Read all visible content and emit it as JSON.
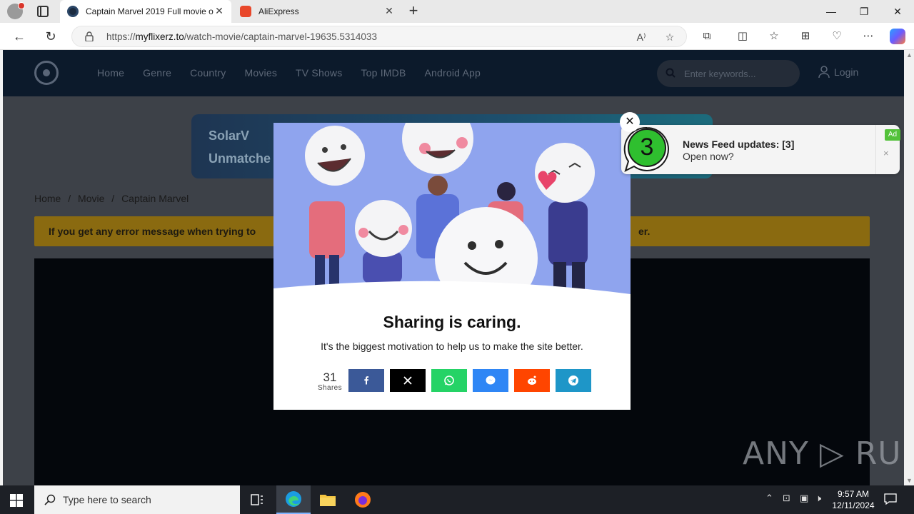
{
  "browser": {
    "tabs": [
      {
        "title": "Captain Marvel 2019 Full movie o",
        "active": true,
        "favicon": "film-reel-icon"
      },
      {
        "title": "AliExpress",
        "active": false,
        "favicon": "aliexpress-icon"
      }
    ],
    "url_prefix": "https://",
    "url_domain": "myflixerz.to",
    "url_path": "/watch-movie/captain-marvel-19635.5314033",
    "window_controls": {
      "minimize": "—",
      "maximize": "❐",
      "close": "✕"
    }
  },
  "site": {
    "nav": [
      "Home",
      "Genre",
      "Country",
      "Movies",
      "TV Shows",
      "Top IMDB",
      "Android App"
    ],
    "search_placeholder": "Enter keywords...",
    "login": "Login",
    "banner_brand": "SolarV",
    "banner_tagline": "Unmatche",
    "breadcrumb": [
      "Home",
      "/",
      "Movie",
      "/",
      "Captain Marvel"
    ],
    "notice_left": "If you get any error message when trying to",
    "notice_right": "er."
  },
  "modal": {
    "title": "Sharing is caring.",
    "subtitle": "It's the biggest motivation to help us to make the site better.",
    "share_count": "31",
    "share_label": "Shares",
    "buttons": [
      {
        "name": "facebook",
        "color": "#3b5998"
      },
      {
        "name": "x",
        "color": "#000000"
      },
      {
        "name": "whatsapp",
        "color": "#25d366"
      },
      {
        "name": "messenger",
        "color": "#2f86f5"
      },
      {
        "name": "reddit",
        "color": "#ff4500"
      },
      {
        "name": "telegram",
        "color": "#1e96c8"
      }
    ]
  },
  "notification": {
    "badge_number": "3",
    "title": "News Feed updates: [3]",
    "text": "Open now?",
    "ad_label": "Ad",
    "close": "×"
  },
  "watermark": "ANY ▷ RUN",
  "taskbar": {
    "search_placeholder": "Type here to search",
    "time": "9:57 AM",
    "date": "12/11/2024"
  }
}
